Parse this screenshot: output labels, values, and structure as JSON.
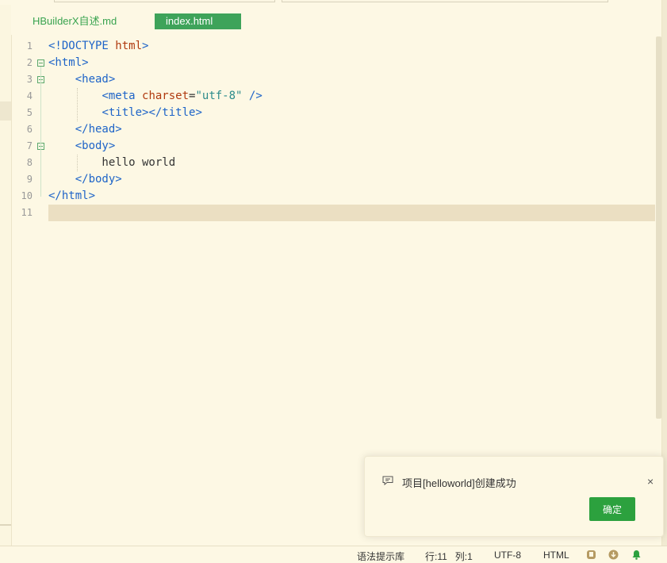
{
  "tabs": [
    {
      "label": "HBuilderX自述.md",
      "active": false
    },
    {
      "label": "index.html",
      "active": true
    }
  ],
  "editor": {
    "lines": [
      {
        "num": "1",
        "tokens": [
          {
            "t": "<!DOCTYPE ",
            "c": "tag"
          },
          {
            "t": "html",
            "c": "attr"
          },
          {
            "t": ">",
            "c": "tag"
          }
        ]
      },
      {
        "num": "2",
        "tokens": [
          {
            "t": "<html>",
            "c": "tag"
          }
        ]
      },
      {
        "num": "3",
        "tokens": [
          {
            "t": "    ",
            "c": "txt"
          },
          {
            "t": "<head>",
            "c": "tag"
          }
        ]
      },
      {
        "num": "4",
        "tokens": [
          {
            "t": "        ",
            "c": "txt"
          },
          {
            "t": "<meta ",
            "c": "tag"
          },
          {
            "t": "charset",
            "c": "attr"
          },
          {
            "t": "=",
            "c": "txt"
          },
          {
            "t": "\"utf-8\"",
            "c": "str"
          },
          {
            "t": " />",
            "c": "tag"
          }
        ]
      },
      {
        "num": "5",
        "tokens": [
          {
            "t": "        ",
            "c": "txt"
          },
          {
            "t": "<title></title>",
            "c": "tag"
          }
        ]
      },
      {
        "num": "6",
        "tokens": [
          {
            "t": "    ",
            "c": "txt"
          },
          {
            "t": "</head>",
            "c": "tag"
          }
        ]
      },
      {
        "num": "7",
        "tokens": [
          {
            "t": "    ",
            "c": "txt"
          },
          {
            "t": "<body>",
            "c": "tag"
          }
        ]
      },
      {
        "num": "8",
        "tokens": [
          {
            "t": "        hello world",
            "c": "txt"
          }
        ]
      },
      {
        "num": "9",
        "tokens": [
          {
            "t": "    ",
            "c": "txt"
          },
          {
            "t": "</body>",
            "c": "tag"
          }
        ]
      },
      {
        "num": "10",
        "tokens": [
          {
            "t": "</html>",
            "c": "tag"
          }
        ]
      },
      {
        "num": "11",
        "tokens": []
      }
    ]
  },
  "notification": {
    "message": "项目[helloworld]创建成功",
    "confirm_label": "确定",
    "close_symbol": "×",
    "icon": "message-icon"
  },
  "statusbar": {
    "syntax_hint": "语法提示库",
    "position": "行:11   列:1",
    "encoding": "UTF-8",
    "language": "HTML"
  },
  "colors": {
    "background": "#fdf8e4",
    "accent_green": "#2ca13e",
    "tag_blue": "#1e64c8",
    "attr_red": "#b03a0f"
  }
}
